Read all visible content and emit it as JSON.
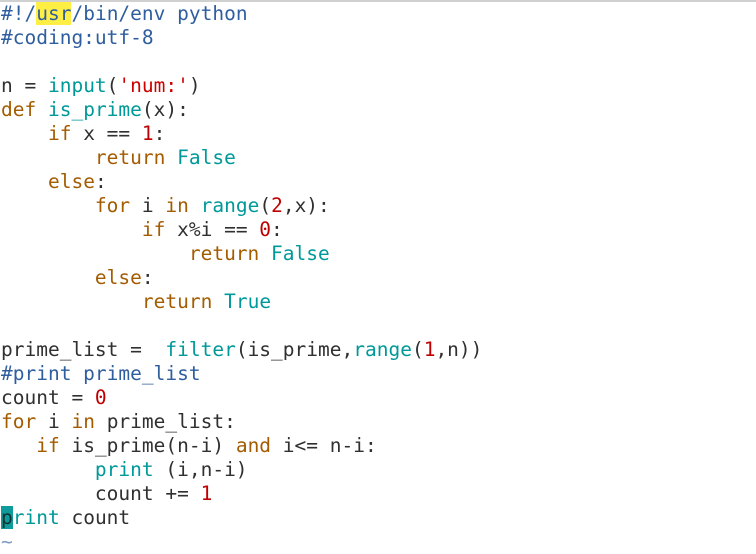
{
  "app": {
    "kind": "terminal-text-editor",
    "language": "python",
    "background_color": "#ffffff",
    "foreground_color": "#303030"
  },
  "colors": {
    "comment": "#2f5e9e",
    "keyword": "#a35c00",
    "builtin": "#009999",
    "number": "#c00000",
    "string": "#cc0000",
    "plain": "#303030",
    "search_highlight_bg": "#ffee44",
    "cursor_bg": "#0f9b9b",
    "top_rule": "#d0d0d0",
    "tilde": "#7f9ac4"
  },
  "editor": {
    "cursor": {
      "line_index": 18,
      "column": 0,
      "char": "p"
    },
    "search_match": {
      "line_index": 0,
      "text": "usr"
    },
    "lines": [
      {
        "index": 0,
        "text": "#!/usr/bin/env python",
        "tokens": [
          {
            "t": "#!/",
            "c": "comment"
          },
          {
            "t": "usr",
            "c": "search"
          },
          {
            "t": "/bin/env python",
            "c": "comment"
          }
        ]
      },
      {
        "index": 1,
        "text": "#coding:utf-8",
        "tokens": [
          {
            "t": "#coding:utf-8",
            "c": "comment"
          }
        ]
      },
      {
        "index": 2,
        "text": "",
        "tokens": []
      },
      {
        "index": 3,
        "text": "n = input('num:')",
        "tokens": [
          {
            "t": "n = ",
            "c": "plain"
          },
          {
            "t": "input",
            "c": "builtin"
          },
          {
            "t": "(",
            "c": "plain"
          },
          {
            "t": "'num:'",
            "c": "string"
          },
          {
            "t": ")",
            "c": "plain"
          }
        ]
      },
      {
        "index": 4,
        "text": "def is_prime(x):",
        "tokens": [
          {
            "t": "def",
            "c": "keyword"
          },
          {
            "t": " ",
            "c": "plain"
          },
          {
            "t": "is_prime",
            "c": "builtin"
          },
          {
            "t": "(x):",
            "c": "plain"
          }
        ]
      },
      {
        "index": 5,
        "text": "    if x == 1:",
        "tokens": [
          {
            "t": "    ",
            "c": "plain"
          },
          {
            "t": "if",
            "c": "keyword"
          },
          {
            "t": " x == ",
            "c": "plain"
          },
          {
            "t": "1",
            "c": "number"
          },
          {
            "t": ":",
            "c": "plain"
          }
        ]
      },
      {
        "index": 6,
        "text": "        return False",
        "tokens": [
          {
            "t": "        ",
            "c": "plain"
          },
          {
            "t": "return",
            "c": "keyword"
          },
          {
            "t": " ",
            "c": "plain"
          },
          {
            "t": "False",
            "c": "builtin"
          }
        ]
      },
      {
        "index": 7,
        "text": "    else:",
        "tokens": [
          {
            "t": "    ",
            "c": "plain"
          },
          {
            "t": "else",
            "c": "keyword"
          },
          {
            "t": ":",
            "c": "plain"
          }
        ]
      },
      {
        "index": 8,
        "text": "        for i in range(2,x):",
        "tokens": [
          {
            "t": "        ",
            "c": "plain"
          },
          {
            "t": "for",
            "c": "keyword"
          },
          {
            "t": " i ",
            "c": "plain"
          },
          {
            "t": "in",
            "c": "keyword"
          },
          {
            "t": " ",
            "c": "plain"
          },
          {
            "t": "range",
            "c": "builtin"
          },
          {
            "t": "(",
            "c": "plain"
          },
          {
            "t": "2",
            "c": "number"
          },
          {
            "t": ",x):",
            "c": "plain"
          }
        ]
      },
      {
        "index": 9,
        "text": "            if x%i == 0:",
        "tokens": [
          {
            "t": "            ",
            "c": "plain"
          },
          {
            "t": "if",
            "c": "keyword"
          },
          {
            "t": " x%i == ",
            "c": "plain"
          },
          {
            "t": "0",
            "c": "number"
          },
          {
            "t": ":",
            "c": "plain"
          }
        ]
      },
      {
        "index": 10,
        "text": "                return False",
        "tokens": [
          {
            "t": "                ",
            "c": "plain"
          },
          {
            "t": "return",
            "c": "keyword"
          },
          {
            "t": " ",
            "c": "plain"
          },
          {
            "t": "False",
            "c": "builtin"
          }
        ]
      },
      {
        "index": 11,
        "text": "        else:",
        "tokens": [
          {
            "t": "        ",
            "c": "plain"
          },
          {
            "t": "else",
            "c": "keyword"
          },
          {
            "t": ":",
            "c": "plain"
          }
        ]
      },
      {
        "index": 12,
        "text": "            return True",
        "tokens": [
          {
            "t": "            ",
            "c": "plain"
          },
          {
            "t": "return",
            "c": "keyword"
          },
          {
            "t": " ",
            "c": "plain"
          },
          {
            "t": "True",
            "c": "builtin"
          }
        ]
      },
      {
        "index": 13,
        "text": "",
        "tokens": []
      },
      {
        "index": 14,
        "text": "prime_list =  filter(is_prime,range(1,n))",
        "tokens": [
          {
            "t": "prime_list =  ",
            "c": "plain"
          },
          {
            "t": "filter",
            "c": "builtin"
          },
          {
            "t": "(is_prime,",
            "c": "plain"
          },
          {
            "t": "range",
            "c": "builtin"
          },
          {
            "t": "(",
            "c": "plain"
          },
          {
            "t": "1",
            "c": "number"
          },
          {
            "t": ",n))",
            "c": "plain"
          }
        ]
      },
      {
        "index": 15,
        "text": "#print prime_list",
        "tokens": [
          {
            "t": "#print prime_list",
            "c": "comment"
          }
        ]
      },
      {
        "index": 16,
        "text": "count = 0",
        "tokens": [
          {
            "t": "count = ",
            "c": "plain"
          },
          {
            "t": "0",
            "c": "number"
          }
        ]
      },
      {
        "index": 17,
        "text": "for i in prime_list:",
        "tokens": [
          {
            "t": "for",
            "c": "keyword"
          },
          {
            "t": " i ",
            "c": "plain"
          },
          {
            "t": "in",
            "c": "keyword"
          },
          {
            "t": " prime_list:",
            "c": "plain"
          }
        ]
      },
      {
        "index": 18,
        "text": "   if is_prime(n-i) and i<= n-i:",
        "tokens": [
          {
            "t": "   ",
            "c": "plain"
          },
          {
            "t": "if",
            "c": "keyword"
          },
          {
            "t": " is_prime(n-i) ",
            "c": "plain"
          },
          {
            "t": "and",
            "c": "keyword"
          },
          {
            "t": " i<= n-i:",
            "c": "plain"
          }
        ]
      },
      {
        "index": 19,
        "text": "        print (i,n-i)",
        "tokens": [
          {
            "t": "        ",
            "c": "plain"
          },
          {
            "t": "print",
            "c": "builtin"
          },
          {
            "t": " (i,n-i)",
            "c": "plain"
          }
        ]
      },
      {
        "index": 20,
        "text": "        count += 1",
        "tokens": [
          {
            "t": "        ",
            "c": "plain"
          },
          {
            "t": "count += ",
            "c": "plain"
          },
          {
            "t": "1",
            "c": "number"
          }
        ]
      },
      {
        "index": 21,
        "text": "print count",
        "tokens": [
          {
            "t": "p",
            "c": "cursor"
          },
          {
            "t": "rint",
            "c": "builtin"
          },
          {
            "t": " count",
            "c": "plain"
          }
        ]
      }
    ],
    "empty_markers": [
      "~"
    ]
  }
}
